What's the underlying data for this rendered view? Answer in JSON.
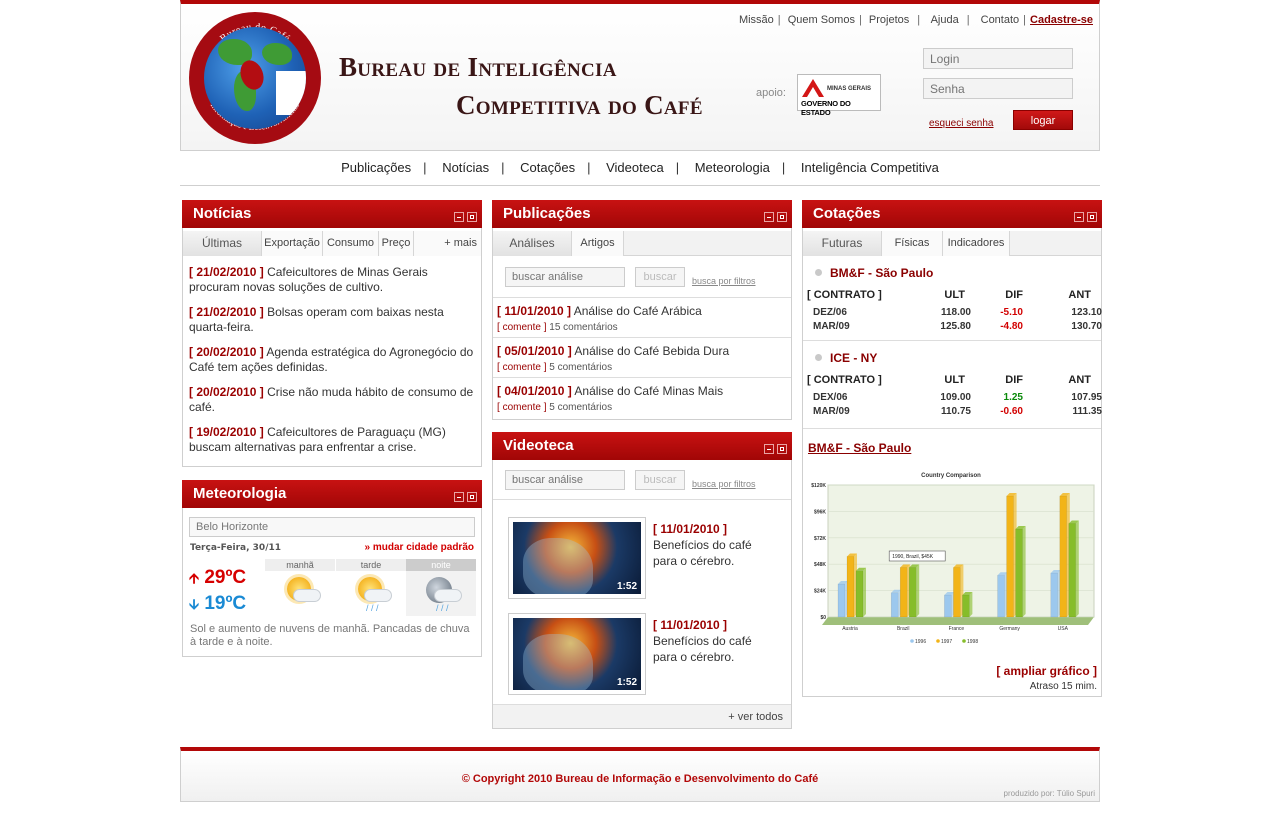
{
  "header": {
    "logo_ring_top": "Bureau do Café",
    "logo_ring_bottom": "Informação e Desenvolvimento",
    "title_line1": "Bureau de Inteligência",
    "title_line2": "Competitiva do Café",
    "top_links": [
      "Missão",
      "Quem Somos",
      "Projetos",
      "Ajuda",
      "Contato"
    ],
    "register": "Cadastre-se",
    "apoio": "apoio:",
    "gov_line1": "MINAS GERAIS",
    "gov_line2": "GOVERNO DO ESTADO",
    "login_placeholder": "Login",
    "password_placeholder": "Senha",
    "forgot": "esqueci senha",
    "login_button": "logar"
  },
  "nav": [
    "Publicações",
    "Notícias",
    "Cotações",
    "Videoteca",
    "Meteorologia",
    "Inteligência Competitiva"
  ],
  "noticias": {
    "title": "Notícias",
    "tabs": [
      "Últimas",
      "Exportação",
      "Consumo",
      "Preço",
      "+ mais"
    ],
    "items": [
      {
        "date": "[ 21/02/2010 ]",
        "text": "Cafeicultores de Minas Gerais procuram novas soluções de cultivo."
      },
      {
        "date": "[ 21/02/2010 ]",
        "text": "Bolsas operam com baixas nesta quarta-feira."
      },
      {
        "date": "[ 20/02/2010 ]",
        "text": "Agenda estratégica do Agronegócio do Café tem ações definidas."
      },
      {
        "date": "[ 20/02/2010 ]",
        "text": "Crise não muda hábito de consumo de café."
      },
      {
        "date": "[ 19/02/2010 ]",
        "text": "Cafeicultores de Paraguaçu (MG) buscam alternativas para enfrentar a crise."
      }
    ]
  },
  "meteorologia": {
    "title": "Meteorologia",
    "city": "Belo Horizonte",
    "date": "Terça-Feira, 30/11",
    "change_city": "» mudar cidade padrão",
    "max": "29ºC",
    "min": "19ºC",
    "periods": [
      "manhã",
      "tarde",
      "noite"
    ],
    "description": "Sol e aumento de nuvens de manhã. Pancadas de chuva à tarde e à noite."
  },
  "publicacoes": {
    "title": "Publicações",
    "tabs": [
      "Análises",
      "Artigos"
    ],
    "search_placeholder": "buscar análise",
    "search_button": "buscar",
    "filters": "busca por filtros",
    "comment_label": "comente",
    "items": [
      {
        "date": "[ 11/01/2010 ]",
        "title": "Análise do Café Arábica",
        "comments": "15 comentários"
      },
      {
        "date": "[ 05/01/2010 ]",
        "title": "Análise do Café Bebida Dura",
        "comments": "5 comentários"
      },
      {
        "date": "[ 04/01/2010 ]",
        "title": "Análise do Café Minas Mais",
        "comments": "5 comentários"
      }
    ]
  },
  "videoteca": {
    "title": "Videoteca",
    "search_placeholder": "buscar análise",
    "search_button": "buscar",
    "filters": "busca por filtros",
    "videos": [
      {
        "date": "[ 11/01/2010 ]",
        "text": "Benefícios do café para o cérebro.",
        "duration": "1:52"
      },
      {
        "date": "[ 11/01/2010 ]",
        "text": "Benefícios do café para o cérebro.",
        "duration": "1:52"
      }
    ],
    "see_all": "+ ver todos"
  },
  "cotacoes": {
    "title": "Cotações",
    "tabs": [
      "Futuras",
      "Físicas",
      "Indicadores"
    ],
    "columns": [
      "[ CONTRATO ]",
      "ULT",
      "DIF",
      "ANT"
    ],
    "markets": [
      {
        "name": "BM&F - São Paulo",
        "rows": [
          {
            "contract": "DEZ/06",
            "ult": "118.00",
            "dif": "-5.10",
            "ant": "123.10",
            "trend": "neg"
          },
          {
            "contract": "MAR/09",
            "ult": "125.80",
            "dif": "-4.80",
            "ant": "130.70",
            "trend": "neg"
          }
        ]
      },
      {
        "name": "ICE - NY",
        "rows": [
          {
            "contract": "DEX/06",
            "ult": "109.00",
            "dif": "1.25",
            "ant": "107.95",
            "trend": "pos"
          },
          {
            "contract": "MAR/09",
            "ult": "110.75",
            "dif": "-0.60",
            "ant": "111.35",
            "trend": "neg"
          }
        ]
      }
    ],
    "chart_link": "BM&F - São Paulo",
    "enlarge": "[ ampliar gráfico ]",
    "delay": "Atraso 15 mim."
  },
  "chart_data": {
    "type": "bar",
    "title": "Country Comparison",
    "categories": [
      "Austria",
      "Brazil",
      "France",
      "Germany",
      "USA"
    ],
    "series": [
      {
        "name": "1996",
        "color": "#9cc8ee",
        "values": [
          30,
          22,
          20,
          38,
          40
        ]
      },
      {
        "name": "1997",
        "color": "#f2b418",
        "values": [
          55,
          45,
          45,
          110,
          110
        ]
      },
      {
        "name": "1998",
        "color": "#86bd2a",
        "values": [
          42,
          45,
          20,
          80,
          85
        ]
      }
    ],
    "yticks": [
      "$0",
      "$24K",
      "$48K",
      "$72K",
      "$96K",
      "$120K"
    ],
    "ylim": [
      0,
      120
    ],
    "tooltip": "1990, Brazil, $45K",
    "legend_position": "bottom"
  },
  "footer": {
    "copyright": "© Copyright 2010 Bureau de Informação e Desenvolvimento do Café",
    "producer": "produzido por: Túlio Spuri"
  }
}
